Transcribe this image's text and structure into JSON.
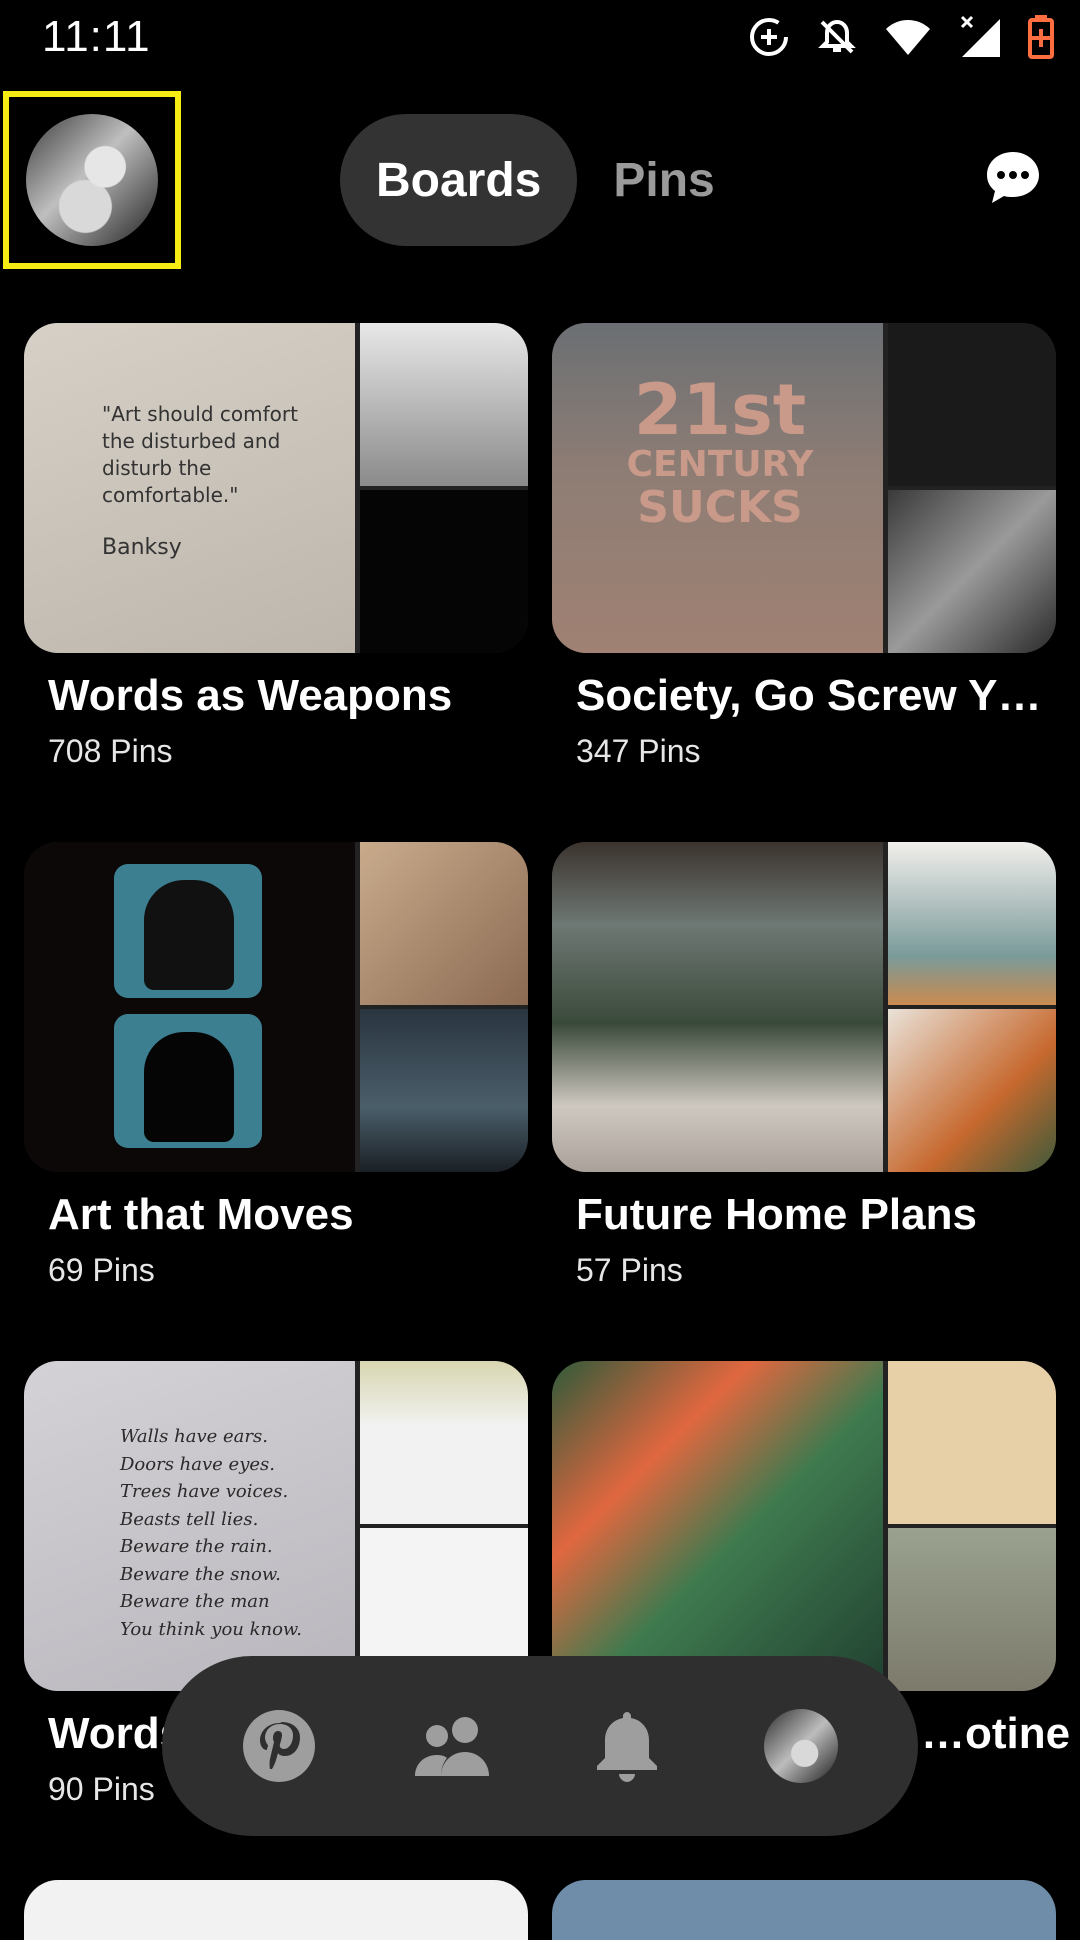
{
  "status_bar": {
    "time": "11:11"
  },
  "header": {
    "tabs": [
      {
        "label": "Boards"
      },
      {
        "label": "Pins"
      }
    ]
  },
  "boards": [
    {
      "name": "Words as Weapons",
      "count": "708 Pins",
      "quote": "\"Art should comfort the disturbed and disturb the comfortable.\"",
      "author": "Banksy"
    },
    {
      "name": "Society, Go Screw Y…",
      "count": "347 Pins",
      "poster_line1": "21st",
      "poster_line2": "CENTURY",
      "poster_line3": "SUCKS"
    },
    {
      "name": "Art that Moves",
      "count": "69 Pins"
    },
    {
      "name": "Future Home Plans",
      "count": "57 Pins"
    },
    {
      "name": "Words",
      "count": "90 Pins",
      "poem": [
        "Walls have ears.",
        "Doors have eyes.",
        "Trees have voices.",
        "Beasts tell lies.",
        "Beware the rain.",
        "Beware the snow.",
        "Beware the man",
        "You think you know."
      ]
    },
    {
      "name": "…otine",
      "count": ""
    }
  ],
  "bottom_nav": {
    "items": [
      "home",
      "following",
      "notifications",
      "profile"
    ]
  },
  "colors": {
    "highlight": "#f7ed12",
    "pill": "#333333",
    "battery": "#ff6e40"
  }
}
